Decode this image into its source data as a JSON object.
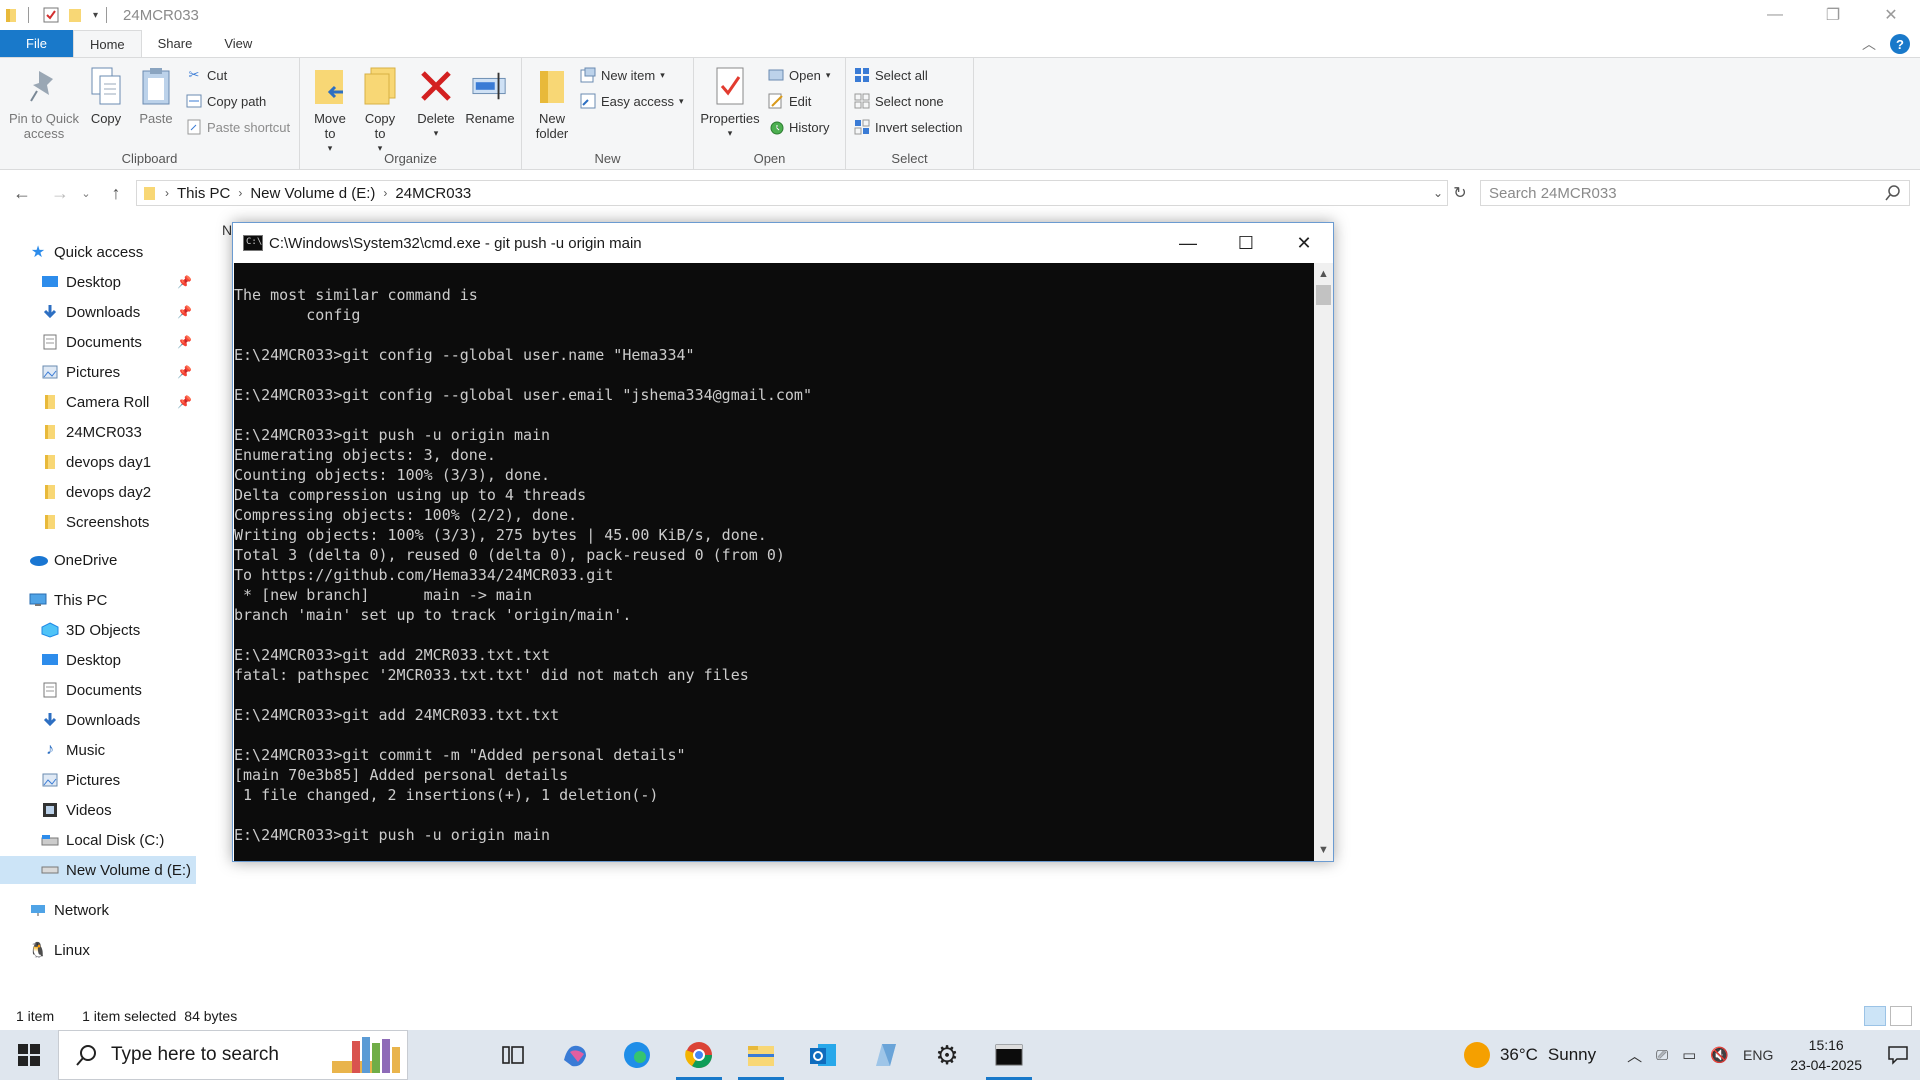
{
  "explorer": {
    "title": "24MCR033",
    "tabs": [
      "File",
      "Home",
      "Share",
      "View"
    ],
    "ribbon": {
      "clipboard": {
        "label": "Clipboard",
        "pin": "Pin to Quick access",
        "copy": "Copy",
        "paste": "Paste",
        "cut": "Cut",
        "copy_path": "Copy path",
        "paste_shortcut": "Paste shortcut"
      },
      "organize": {
        "label": "Organize",
        "move_to": "Move to",
        "copy_to": "Copy to",
        "delete": "Delete",
        "rename": "Rename"
      },
      "new": {
        "label": "New",
        "new_folder": "New folder",
        "new_item": "New item",
        "easy_access": "Easy access"
      },
      "open": {
        "label": "Open",
        "properties": "Properties",
        "open": "Open",
        "edit": "Edit",
        "history": "History"
      },
      "select": {
        "label": "Select",
        "select_all": "Select all",
        "select_none": "Select none",
        "invert_selection": "Invert selection"
      }
    },
    "address": {
      "crumbs": [
        "This PC",
        "New Volume d (E:)",
        "24MCR033"
      ]
    },
    "search": {
      "placeholder": "Search 24MCR033"
    },
    "nav": {
      "quick_access": "Quick access",
      "quick_items": [
        "Desktop",
        "Downloads",
        "Documents",
        "Pictures",
        "Camera Roll",
        "24MCR033",
        "devops day1",
        "devops day2",
        "Screenshots"
      ],
      "onedrive": "OneDrive",
      "this_pc": "This PC",
      "pc_items": [
        "3D Objects",
        "Desktop",
        "Documents",
        "Downloads",
        "Music",
        "Pictures",
        "Videos",
        "Local Disk (C:)",
        "New Volume d (E:)"
      ],
      "network": "Network",
      "linux": "Linux"
    },
    "status": {
      "items": "1 item",
      "selected": "1 item selected",
      "size": "84 bytes"
    },
    "column_hint": "N"
  },
  "cmd": {
    "title": "C:\\Windows\\System32\\cmd.exe - git  push -u origin main",
    "lines": [
      "The most similar command is",
      "        config",
      "",
      "E:\\24MCR033>git config --global user.name \"Hema334\"",
      "",
      "E:\\24MCR033>git config --global user.email \"jshema334@gmail.com\"",
      "",
      "E:\\24MCR033>git push -u origin main",
      "Enumerating objects: 3, done.",
      "Counting objects: 100% (3/3), done.",
      "Delta compression using up to 4 threads",
      "Compressing objects: 100% (2/2), done.",
      "Writing objects: 100% (3/3), 275 bytes | 45.00 KiB/s, done.",
      "Total 3 (delta 0), reused 0 (delta 0), pack-reused 0 (from 0)",
      "To https://github.com/Hema334/24MCR033.git",
      " * [new branch]      main -> main",
      "branch 'main' set up to track 'origin/main'.",
      "",
      "E:\\24MCR033>git add 2MCR033.txt.txt",
      "fatal: pathspec '2MCR033.txt.txt' did not match any files",
      "",
      "E:\\24MCR033>git add 24MCR033.txt.txt",
      "",
      "E:\\24MCR033>git commit -m \"Added personal details\"",
      "[main 70e3b85] Added personal details",
      " 1 file changed, 2 insertions(+), 1 deletion(-)",
      "",
      "E:\\24MCR033>git push -u origin main"
    ]
  },
  "taskbar": {
    "search_placeholder": "Type here to search",
    "weather": {
      "temp": "36°C",
      "condition": "Sunny"
    },
    "lang": "ENG",
    "time": "15:16",
    "date": "23-04-2025"
  },
  "colors": {
    "accent": "#1979ca",
    "console_bg": "#0c0c0c",
    "console_fg": "#cccccc",
    "folder": "#f8d775"
  }
}
